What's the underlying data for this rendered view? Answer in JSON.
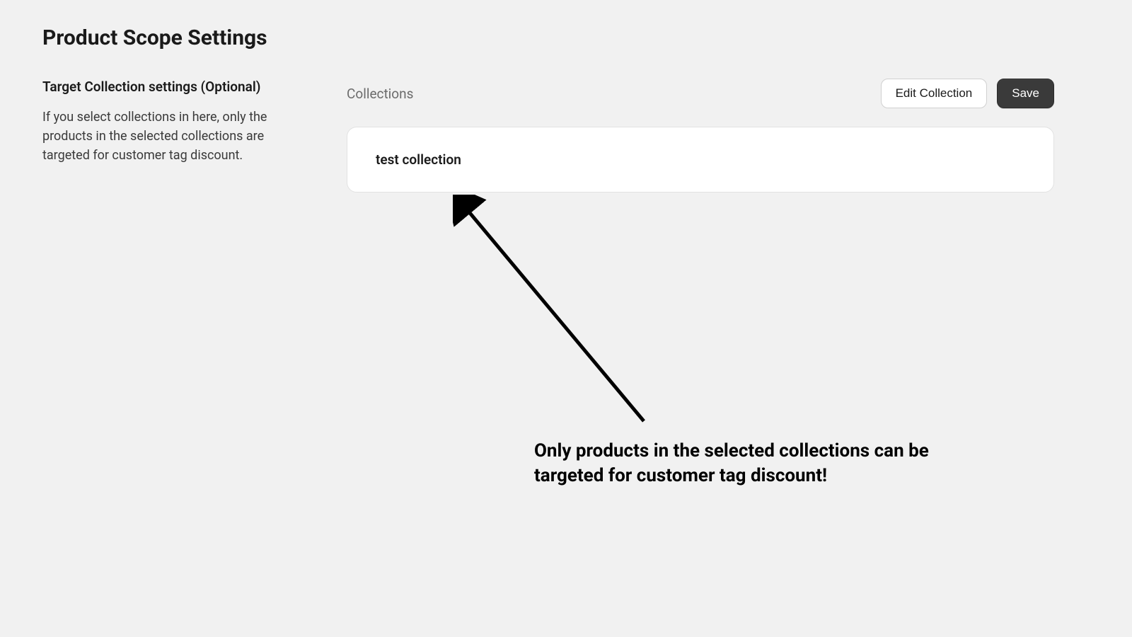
{
  "header": {
    "title": "Product Scope Settings"
  },
  "left": {
    "heading": "Target Collection settings (Optional)",
    "description": "If you select collections in here, only the products in the selected collections are targeted for customer tag discount."
  },
  "right": {
    "label": "Collections",
    "edit_button": "Edit Collection",
    "save_button": "Save",
    "collection_item": "test collection"
  },
  "annotation": {
    "text": "Only products in the selected collections can be targeted for customer tag discount!"
  }
}
